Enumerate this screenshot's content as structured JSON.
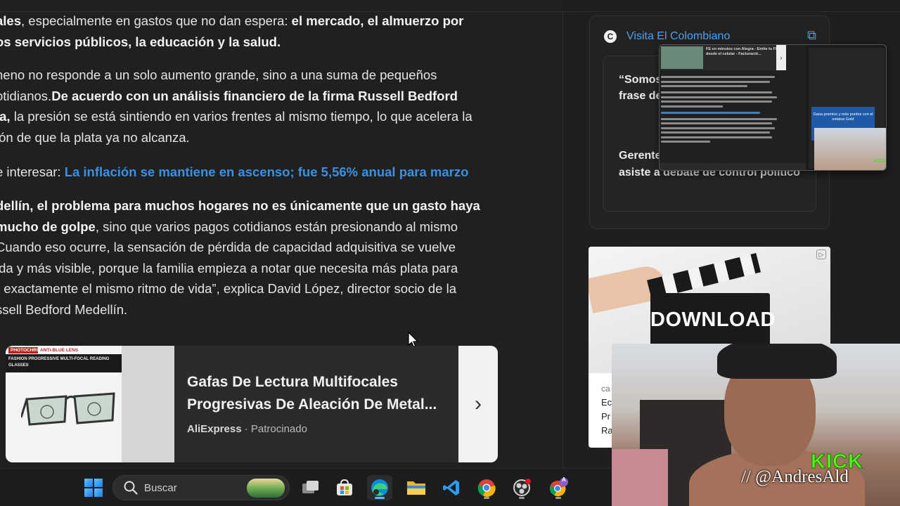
{
  "article": {
    "p1": {
      "l1_a": "ales",
      "l1_b": ", especialmente en gastos que no dan espera: ",
      "l1_c": "el mercado, el almuerzo por",
      "l2": "os servicios públicos, la educación y la salud."
    },
    "p2": {
      "l1": "neno no responde a un solo aumento grande, sino a una suma de pequeños",
      "l2_a": "otidianos.",
      "l2_b": "De acuerdo con un análisis financiero de la firma Russell Bedford",
      "l3_a": "ia,",
      "l3_b": " la presión se está sintiendo en varios frentes al mismo tiempo, lo que acelera la",
      "l4": "ión de que la plata ya no alcanza."
    },
    "related": {
      "prefix": "e interesar: ",
      "link": "La inflación se mantiene en ascenso; fue 5,56% anual para marzo"
    },
    "p3": {
      "l1": "dellín, el problema para muchos hogares no es únicamente que un gasto haya",
      "l2_a": "mucho de golpe",
      "l2_b": ", sino que varios pagos cotidianos están presionando al mismo",
      "l3": "Cuando eso ocurre, la sensación de pérdida de capacidad adquisitiva se vuelve",
      "l4": "ida y más visible, porque la familia empieza a notar que necesita más plata para",
      "l5": "r exactamente el mismo ritmo de vida”, explica David López, director socio de la",
      "l6": "ssell Bedford Medellín."
    }
  },
  "sponsored": {
    "badge1": "PHOTOCHROMIC",
    "badge2": "ANTI-BLUE LENS",
    "strip": "FASHION PROGRESSIVE MULTI-FOCAL READING GLASSES",
    "title": "Gafas De Lectura Multifocales Progresivas De Aleación De Metal...",
    "source": "AliExpress",
    "separator": " · ",
    "label": "Patrocinado"
  },
  "sidebar": {
    "visit_label": "Visita El Colombiano",
    "logo_letter": "C",
    "quote1": "“Somos",
    "quote1_b": "frase de",
    "quote2_a": "Gerente",
    "quote2_b": "asiste a debate de control político"
  },
  "ad": {
    "clapper_text": "DOWNLOAD",
    "info": "▷",
    "source_frag": "ca",
    "l1": "Ec",
    "l2": "Pr",
    "l3": "Ra"
  },
  "preview": {
    "ad_text": "FE en minutos con Alegra - Emite tu FE desde el celular - Facturació...",
    "blue_text": "Gana premios y más puntos con el estatus Gold",
    "kick": "KICK"
  },
  "webcam": {
    "kick": "KICK",
    "handle": "// @AndresAld"
  },
  "taskbar": {
    "search_placeholder": "Buscar",
    "icons": [
      "windows-start-icon",
      "search-icon",
      "task-view-icon",
      "store-icon",
      "edge-icon",
      "file-explorer-icon",
      "vscode-icon",
      "chrome-icon",
      "obs-icon",
      "chrome-profile-icon"
    ],
    "chrome_profile_badge": "A"
  },
  "colors": {
    "background": "#202020",
    "link": "#3d8fe0",
    "kick_green": "#53fc18",
    "vc_blue": "#4aa3f0"
  }
}
